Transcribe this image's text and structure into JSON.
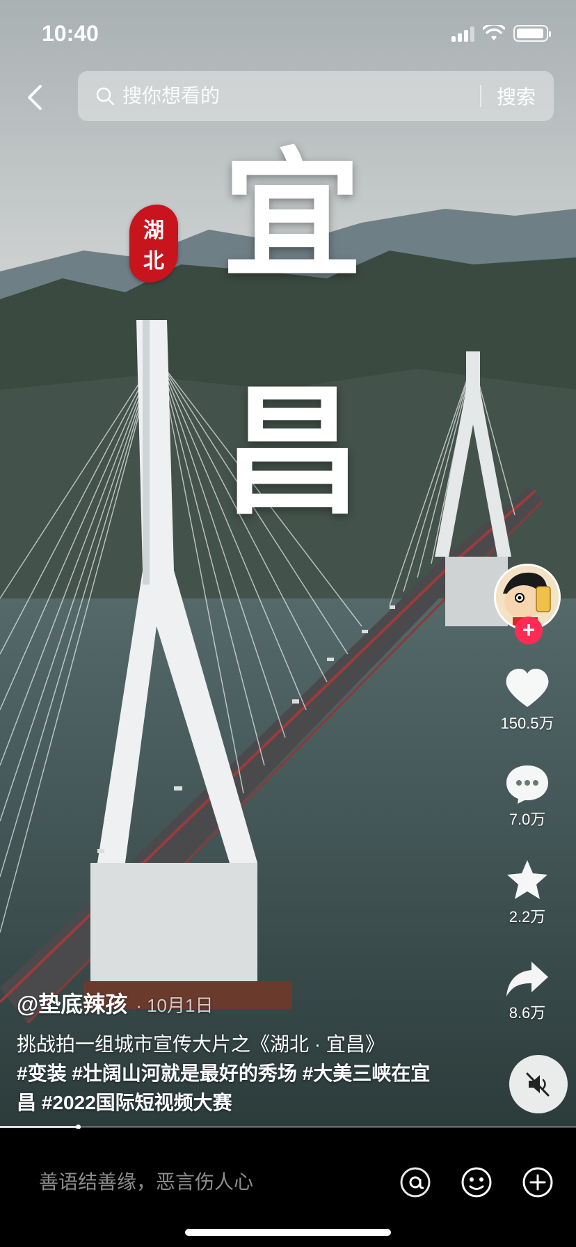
{
  "status_bar": {
    "time": "10:40"
  },
  "search": {
    "placeholder": "搜你想看的",
    "button_label": "搜索"
  },
  "video": {
    "title_chars": [
      "宜",
      "昌"
    ],
    "seal_chars": [
      "湖",
      "北"
    ]
  },
  "author": {
    "handle": "@垫底辣孩",
    "date": "· 10月1日"
  },
  "caption": {
    "text": "挑战拍一组城市宣传大片之《湖北 · 宜昌》",
    "tags": [
      "#变装",
      "#壮阔山河就是最好的秀场",
      "#大美三峡在宜昌",
      "#2022国际短视频大赛"
    ]
  },
  "actions": {
    "likes": "150.5万",
    "comments": "7.0万",
    "favorites": "2.2万",
    "shares": "8.6万"
  },
  "playback": {
    "progress_percent": 13.5
  },
  "comment_bar": {
    "placeholder": "善语结善缘，恶言伤人心"
  },
  "colors": {
    "accent": "#fe2c55",
    "seal": "#c8141c"
  }
}
